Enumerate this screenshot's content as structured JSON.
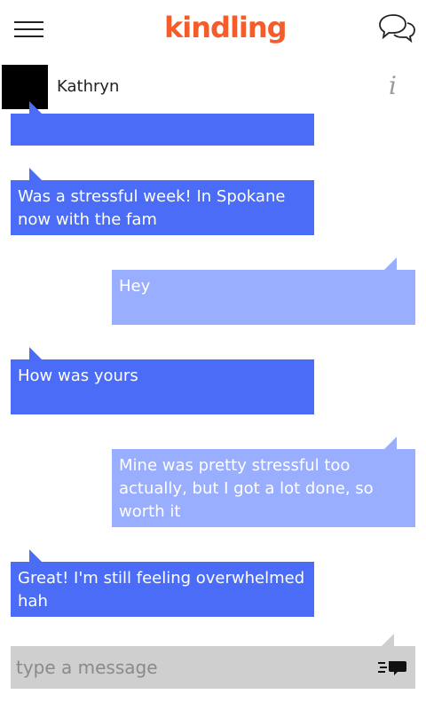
{
  "header": {
    "logo_text": "kindling"
  },
  "contact": {
    "name": "Kathryn"
  },
  "messages": [
    {
      "direction": "incoming",
      "text": ""
    },
    {
      "direction": "incoming",
      "text": "Was a stressful week! In Spokane now with the fam"
    },
    {
      "direction": "outgoing",
      "text": "Hey"
    },
    {
      "direction": "incoming",
      "text": "How was yours"
    },
    {
      "direction": "outgoing",
      "text": "Mine was pretty stressful too actually, but I got a lot done, so worth it"
    },
    {
      "direction": "incoming",
      "text": "Great! I'm still feeling overwhelmed hah"
    }
  ],
  "composer": {
    "placeholder": "type a message"
  },
  "colors": {
    "brand": "#f45c2b",
    "incoming_bubble": "#4a6cf7",
    "outgoing_bubble": "#9aaeff",
    "composer_bg": "#cfcfcf"
  },
  "icons": {
    "menu": "hamburger-icon",
    "chats": "chat-bubbles-icon",
    "info": "info-icon",
    "send": "send-icon"
  }
}
